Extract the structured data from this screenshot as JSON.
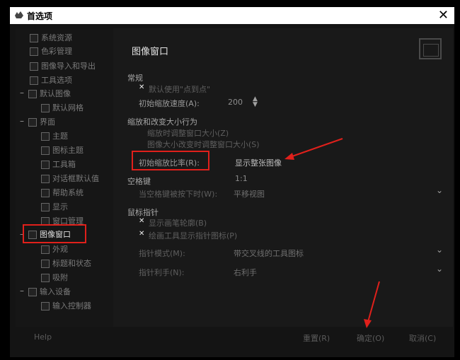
{
  "window": {
    "title": "首选项",
    "close_glyph": "✕"
  },
  "sidebar": {
    "items": [
      {
        "label": "系统资源"
      },
      {
        "label": "色彩管理"
      },
      {
        "label": "图像导入和导出"
      },
      {
        "label": "工具选项"
      },
      {
        "label": "默认图像"
      },
      {
        "label": "默认网格"
      },
      {
        "label": "界面"
      },
      {
        "label": "主题"
      },
      {
        "label": "图标主题"
      },
      {
        "label": "工具箱"
      },
      {
        "label": "对话框默认值"
      },
      {
        "label": "帮助系统"
      },
      {
        "label": "显示"
      },
      {
        "label": "窗口管理"
      },
      {
        "label": "图像窗口"
      },
      {
        "label": "外观"
      },
      {
        "label": "标题和状态"
      },
      {
        "label": "吸附"
      },
      {
        "label": "输入设备"
      },
      {
        "label": "输入控制器"
      }
    ]
  },
  "content": {
    "page_title": "图像窗口",
    "general": {
      "heading": "常规",
      "checkbox_label": "默认使用\"点到点\"",
      "speed_label": "初始缩放速度(A):",
      "speed_value": "200"
    },
    "zoom": {
      "heading": "缩放和改变大小行为",
      "option1": "缩放时调整窗口大小(Z)",
      "option2": "图像大小改变时调整窗口大小(S)",
      "ratio_label": "初始缩放比率(R):",
      "ratio_value": "显示整张图像"
    },
    "space": {
      "heading": "空格键",
      "value_top": "1:1",
      "label": "当空格键被按下时(W):",
      "value": "平移视图"
    },
    "pointer": {
      "heading": "鼠标指针",
      "check1_label": "显示画笔轮廓(B)",
      "check2_label": "绘画工具显示指针图标(P)",
      "mode_label": "指针模式(M):",
      "mode_value": "带交叉线的工具图标",
      "hand_label": "指针利手(N):",
      "hand_value": "右利手"
    }
  },
  "footer": {
    "help": "Help",
    "reset": "重置(R)",
    "ok": "确定(O)",
    "cancel": "取消(C)"
  },
  "icons": {
    "check": "✕",
    "collapse": "–",
    "spin_up": "▲",
    "spin_down": "▼",
    "chevron": "⌄"
  },
  "colors": {
    "annotation_red": "#e0201b",
    "background": "#000000"
  }
}
